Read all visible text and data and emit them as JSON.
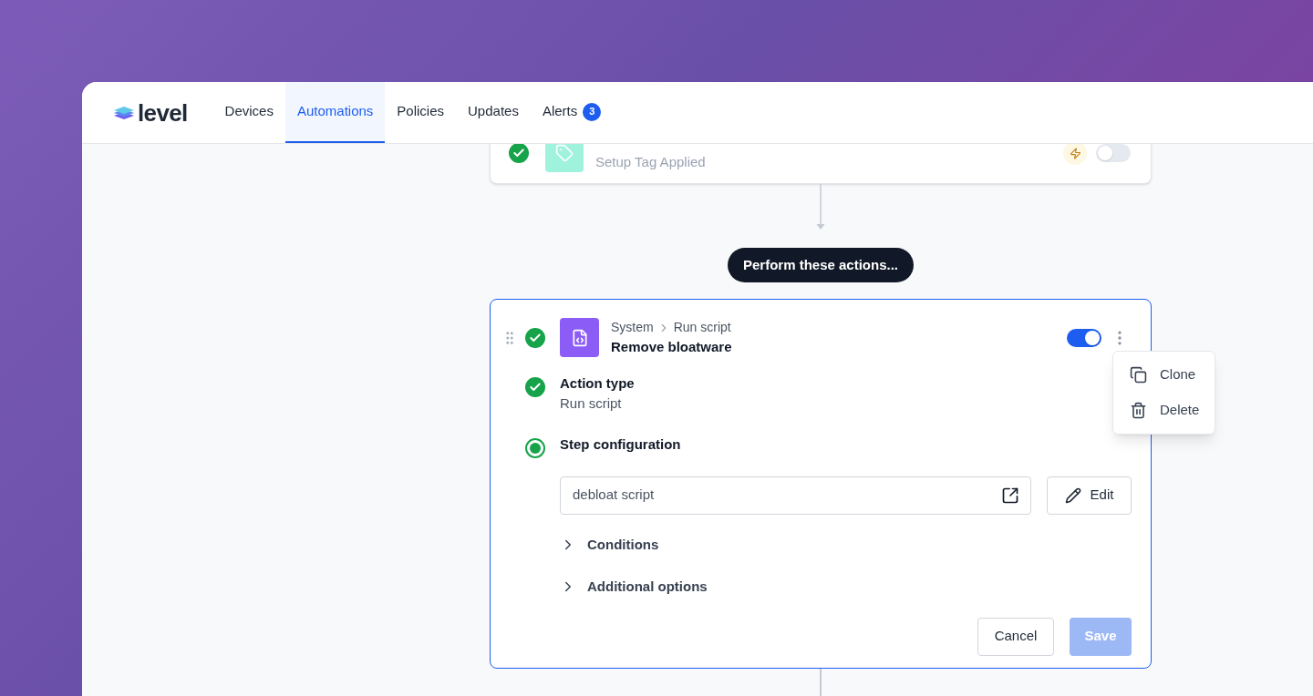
{
  "brand": {
    "name": "level"
  },
  "nav": [
    {
      "label": "Devices",
      "selected": false
    },
    {
      "label": "Automations",
      "selected": true
    },
    {
      "label": "Policies",
      "selected": false
    },
    {
      "label": "Updates",
      "selected": false
    },
    {
      "label": "Alerts",
      "selected": false,
      "badge": "3"
    }
  ],
  "trigger_card": {
    "title": "Setup Tag Applied",
    "done": true,
    "on": false
  },
  "actions_label": "Perform these actions...",
  "action_card": {
    "breadcrumb": [
      "System",
      "Run script"
    ],
    "title": "Remove bloatware",
    "done": true,
    "on": true,
    "menu": [
      {
        "kind": "clone",
        "label": "Clone"
      },
      {
        "kind": "delete",
        "label": "Delete"
      }
    ],
    "steps": [
      {
        "title": "Action type",
        "value": "Run script",
        "done": true
      },
      {
        "title": "Step configuration",
        "done": false,
        "current": true
      }
    ],
    "script_field": {
      "value": "debloat script"
    },
    "edit_button": "Edit",
    "sections": [
      {
        "label": "Conditions",
        "expanded": false
      },
      {
        "label": "Additional options",
        "expanded": false
      }
    ],
    "cancel_button": "Cancel",
    "save_button": {
      "label": "Save",
      "disabled": true
    }
  }
}
